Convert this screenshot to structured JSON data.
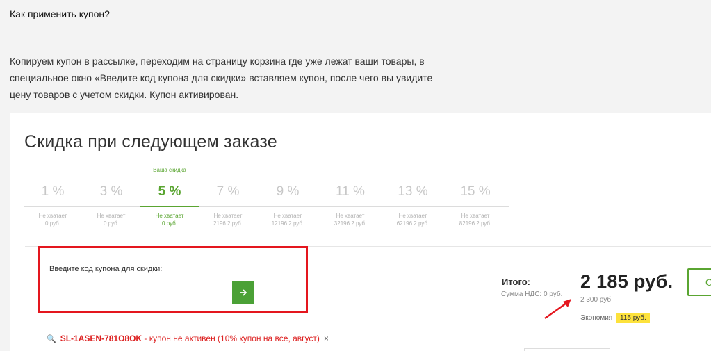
{
  "faq": {
    "title": "Как применить купон?",
    "text": "Копируем купон в рассылке, переходим на страницу корзина где уже лежат ваши товары, в специальное окно «Введите код купона для скидки» вставляем купон, после чего вы увидите цену товаров с учетом скидки. Купон активирован."
  },
  "discount": {
    "title": "Скидка при следующем заказе",
    "your_discount_label": "Ваша скидка",
    "tiers": [
      {
        "pct": "1 %",
        "need1": "Не хватает",
        "need2": "0 руб."
      },
      {
        "pct": "3 %",
        "need1": "Не хватает",
        "need2": "0 руб."
      },
      {
        "pct": "5 %",
        "need1": "Не хватает",
        "need2": "0 руб."
      },
      {
        "pct": "7 %",
        "need1": "Не хватает",
        "need2": "2196.2 руб."
      },
      {
        "pct": "9 %",
        "need1": "Не хватает",
        "need2": "12196.2 руб."
      },
      {
        "pct": "11 %",
        "need1": "Не хватает",
        "need2": "32196.2 руб."
      },
      {
        "pct": "13 %",
        "need1": "Не хватает",
        "need2": "62196.2 руб."
      },
      {
        "pct": "15 %",
        "need1": "Не хватает",
        "need2": "82196.2 руб."
      }
    ],
    "active_index": 2
  },
  "coupon": {
    "label": "Введите код купона для скидки:",
    "input_value": "",
    "button_icon": "arrow-right-icon",
    "status_code": "SL-1ASEN-781O8OK",
    "status_message": " - купон не активен (10% купон на все, август)",
    "remove_symbol": "×"
  },
  "total": {
    "label": "Итого:",
    "vat": "Сумма НДС: 0 руб.",
    "price": "2 185 руб.",
    "old_price": "2 300 руб.",
    "savings_label": "Экономия",
    "savings_value": "115 руб.",
    "checkout_label": "О"
  },
  "colors": {
    "accent_green": "#5aa531",
    "highlight_red": "#e4161e",
    "badge_yellow": "#fde23c"
  }
}
